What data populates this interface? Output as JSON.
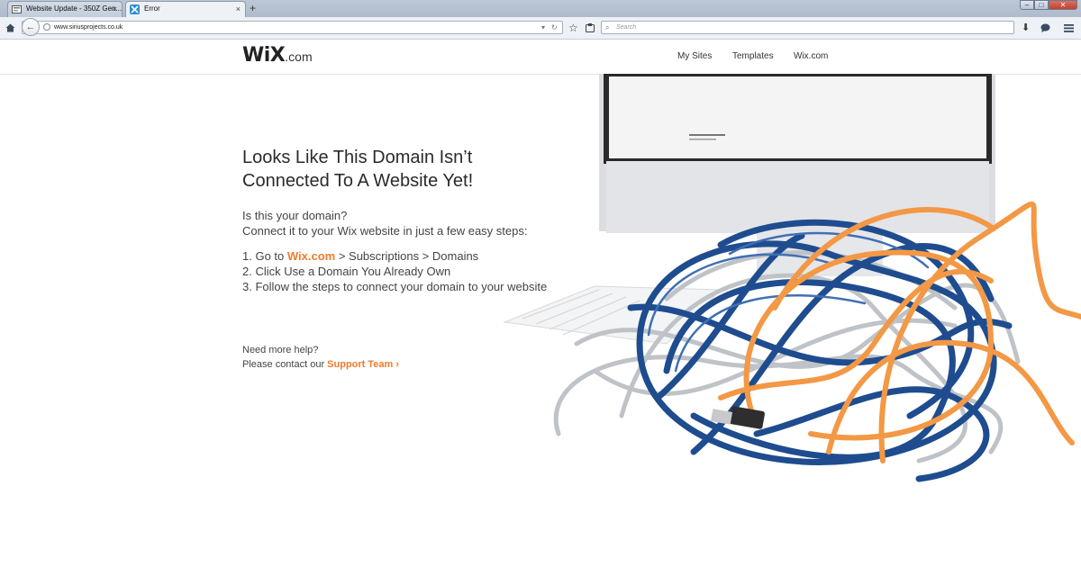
{
  "browser": {
    "tabs": [
      {
        "title": "Website Update - 350Z Gen...",
        "close": "×"
      },
      {
        "title": "Error",
        "close": "×"
      }
    ],
    "new_tab": "+",
    "window_controls": {
      "minimize": "–",
      "maximize": "□",
      "close": "✕"
    },
    "url": "www.siriusprojects.co.uk",
    "search_placeholder": "Search",
    "icons": [
      "home-icon",
      "back-arrow-icon",
      "globe-icon",
      "dropdown-icon",
      "reload-icon",
      "bookmark-star-icon",
      "reading-list-icon",
      "search-icon",
      "download-icon",
      "chat-icon",
      "hamburger-menu-icon"
    ]
  },
  "header": {
    "logo_main": "WiX",
    "logo_suffix": ".com",
    "nav": [
      "My Sites",
      "Templates",
      "Wix.com"
    ]
  },
  "content": {
    "headline_line1": "Looks Like This Domain Isn’t",
    "headline_line2": "Connected To A Website Yet!",
    "intro_line1": "Is this your domain?",
    "intro_line2": "Connect it to your Wix website in just a few easy steps:",
    "step1_prefix": "1. Go to ",
    "step1_link": "Wix.com",
    "step1_suffix": " > Subscriptions > Domains",
    "step2": "2. Click Use a Domain You Already Own",
    "step3": "3. Follow the steps to connect your domain to your website",
    "help_line1": "Need more help?",
    "help_line2_prefix": "Please contact our ",
    "support_link": "Support Team",
    "support_chevron": "›"
  },
  "colors": {
    "accent": "#f07b2d",
    "text": "#2b2b2b",
    "cable_blue": "#1e4c8f",
    "cable_orange": "#f39845"
  }
}
